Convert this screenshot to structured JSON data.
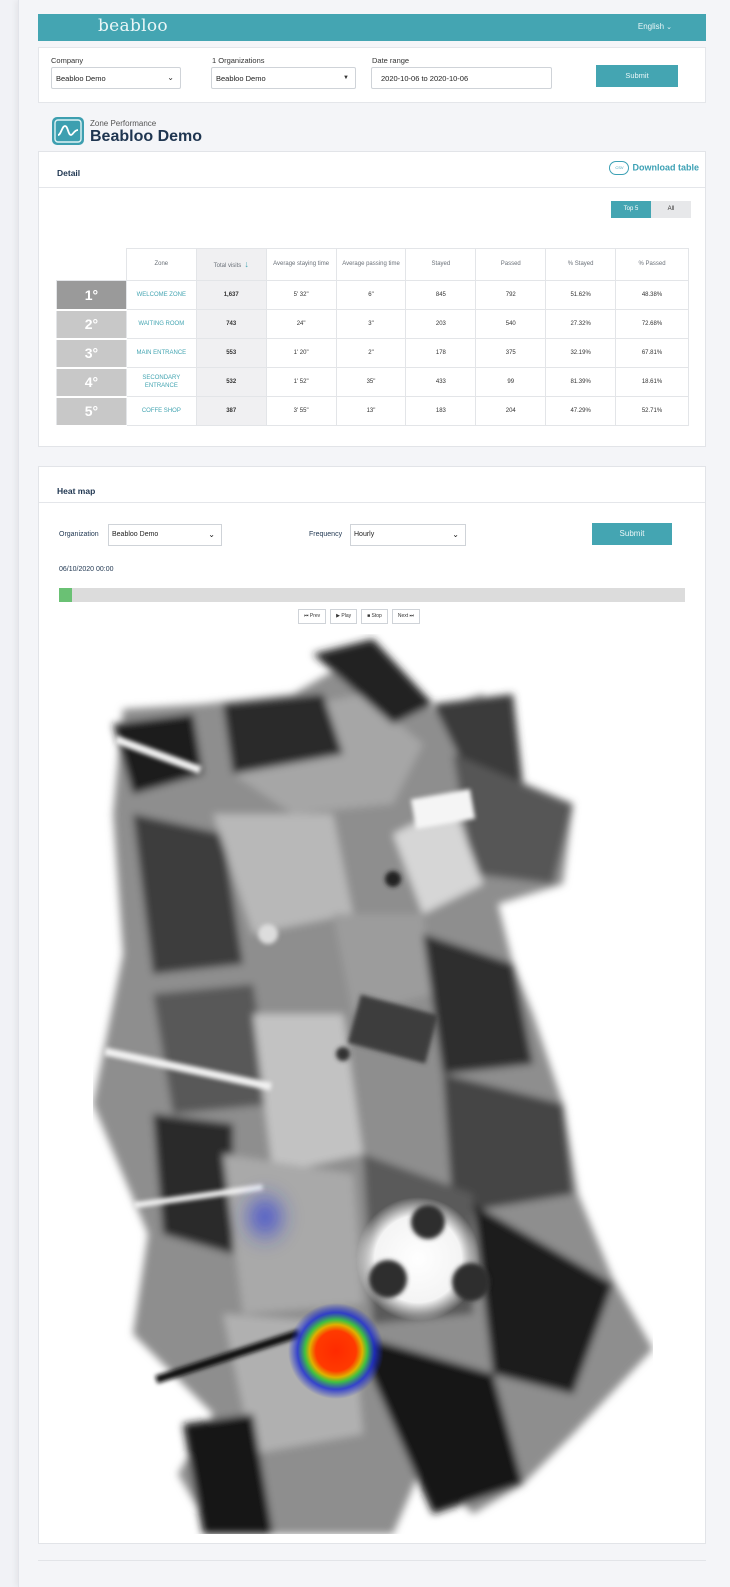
{
  "header": {
    "brand": "beabloo",
    "language": "English"
  },
  "filters": {
    "company_label": "Company",
    "company_value": "Beabloo Demo",
    "orgs_label": "1 Organizations",
    "orgs_value": "Beabloo Demo",
    "date_label": "Date range",
    "date_value": "2020-10-06 to 2020-10-06",
    "submit": "Submit"
  },
  "page": {
    "subtitle": "Zone Performance",
    "title": "Beabloo Demo"
  },
  "detail": {
    "title": "Detail",
    "download": "Download table",
    "download_icon_text": "CSV",
    "toggle": [
      "Top 5",
      "All"
    ],
    "columns": [
      "Zone",
      "Total visits",
      "Average staying time",
      "Average passing time",
      "Stayed",
      "Passed",
      "% Stayed",
      "% Passed"
    ],
    "rows": [
      {
        "rank": "1°",
        "zone": "WELCOME ZONE",
        "total": "1,637",
        "stay": "5' 32\"",
        "pass": "6\"",
        "stayed": "845",
        "passed": "792",
        "pstayed": "51.62%",
        "ppassed": "48.38%"
      },
      {
        "rank": "2°",
        "zone": "WAITING ROOM",
        "total": "743",
        "stay": "24\"",
        "pass": "3\"",
        "stayed": "203",
        "passed": "540",
        "pstayed": "27.32%",
        "ppassed": "72.68%"
      },
      {
        "rank": "3°",
        "zone": "MAIN ENTRANCE",
        "total": "553",
        "stay": "1' 20\"",
        "pass": "2\"",
        "stayed": "178",
        "passed": "375",
        "pstayed": "32.19%",
        "ppassed": "67.81%"
      },
      {
        "rank": "4°",
        "zone": "SECONDARY ENTRANCE",
        "total": "532",
        "stay": "1' 52\"",
        "pass": "35\"",
        "stayed": "433",
        "passed": "99",
        "pstayed": "81.39%",
        "ppassed": "18.61%"
      },
      {
        "rank": "5°",
        "zone": "COFFE SHOP",
        "total": "387",
        "stay": "3' 55\"",
        "pass": "13\"",
        "stayed": "183",
        "passed": "204",
        "pstayed": "47.29%",
        "ppassed": "52.71%"
      }
    ]
  },
  "heatmap": {
    "title": "Heat map",
    "org_label": "Organization",
    "org_value": "Beabloo Demo",
    "freq_label": "Frequency",
    "freq_value": "Hourly",
    "submit": "Submit",
    "timestamp": "06/10/2020 00:00",
    "progress": 0.02,
    "controls": [
      "⏮ Prev",
      "▶ Play",
      "■ Stop",
      "Next ⏭"
    ]
  }
}
